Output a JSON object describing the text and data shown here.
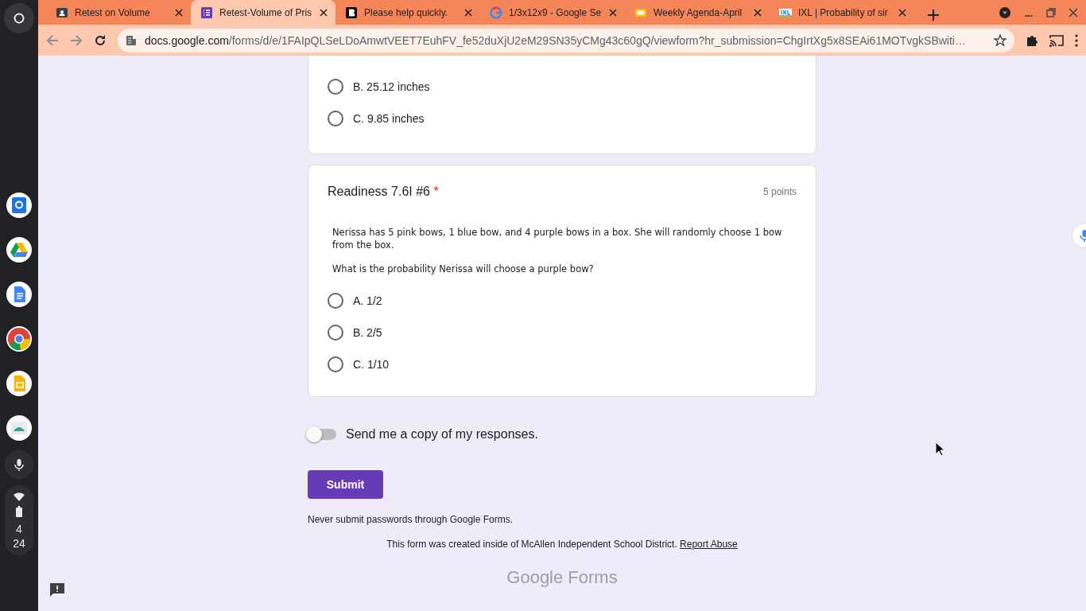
{
  "shelf": {
    "clock": {
      "hour": "4",
      "minute": "24"
    }
  },
  "browser": {
    "tabs": [
      {
        "title": "Retest on Volume",
        "selected": false
      },
      {
        "title": "Retest-Volume of Pris",
        "selected": true
      },
      {
        "title": "Please help quickly.",
        "selected": false
      },
      {
        "title": "1/3x12x9 - Google Se",
        "selected": false
      },
      {
        "title": "Weekly Agenda-April",
        "selected": false
      },
      {
        "title": "IXL | Probability of sir",
        "selected": false
      }
    ],
    "address": {
      "domain": "docs.google.com",
      "path": "/forms/d/e/1FAIpQLSeLDoAmwtVEET7EuhFV_fe52duXjU2eM29SN35yCMg43c60gQ/viewform?hr_submission=ChgIrtXg5x8SEAi61MOTvgkSBwiti…"
    }
  },
  "form": {
    "questions": [
      {
        "options": [
          {
            "label": "B. 25.12 inches",
            "selected": false
          },
          {
            "label": "C. 9.85 inches",
            "selected": false
          }
        ]
      },
      {
        "title": "Readiness 7.6I #6",
        "required": true,
        "required_mark": "*",
        "points": "5 points",
        "prompt": [
          "Nerissa has 5 pink bows, 1 blue bow, and 4 purple bows in a box. She will randomly choose 1 bow from the box.",
          "What is the probability Nerissa will choose a purple bow?"
        ],
        "options": [
          {
            "label": "A. 1/2",
            "selected": false
          },
          {
            "label": "B. 2/5",
            "selected": false
          },
          {
            "label": "C. 1/10",
            "selected": false
          }
        ]
      }
    ],
    "copy_toggle": {
      "label": "Send me a copy of my responses.",
      "on": false
    },
    "submit": "Submit",
    "note": "Never submit passwords through Google Forms.",
    "footer": {
      "text": "This form was created inside of McAllen Independent School District.",
      "link": "Report Abuse"
    },
    "brand": "Google Forms"
  }
}
